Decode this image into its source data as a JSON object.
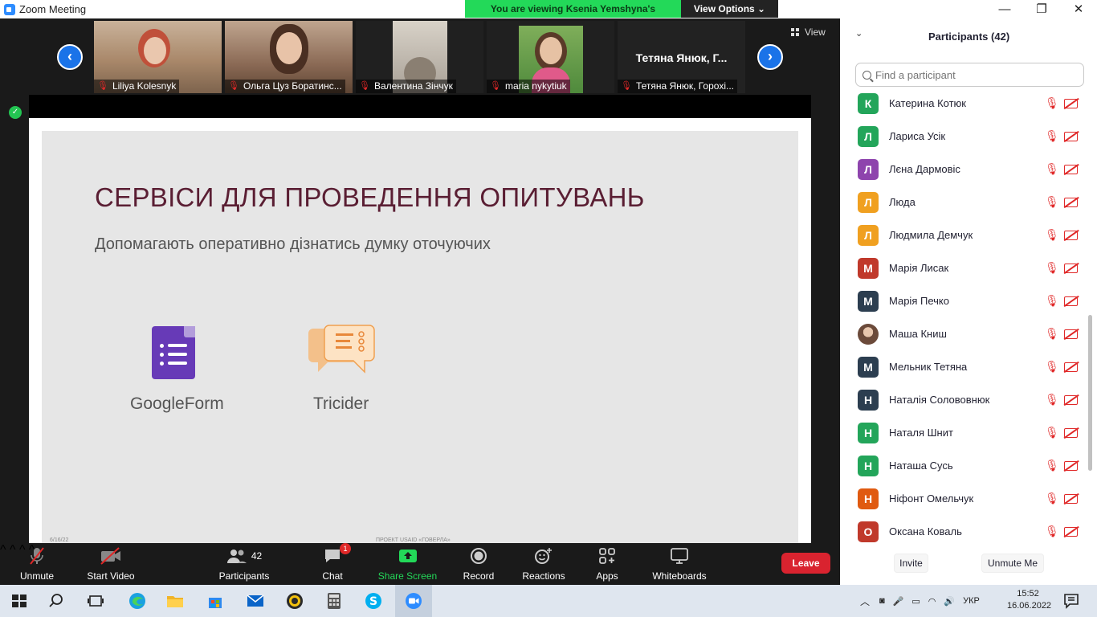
{
  "window": {
    "title": "Zoom Meeting",
    "viewing_banner": "You are viewing Ksenia Yemshyna's screen",
    "view_options": "View Options ⌄"
  },
  "gallery": {
    "view_label": "View",
    "tiles": [
      {
        "name": "Liliya Kolesnyk",
        "photo_color": "#a9886a"
      },
      {
        "name": "Ольга Цуз Боратинс...",
        "photo_color": "#8b6a55"
      },
      {
        "name": "Валентина Зінчук",
        "photo_color": "#c8c2b8"
      },
      {
        "name": "maria nykytiuk",
        "photo_color": "#4f8a3c"
      },
      {
        "name": "Тетяна Янюк, Горохі...",
        "big_name": "Тетяна Янюк, Г..."
      }
    ]
  },
  "slide": {
    "title": "СЕРВІСИ ДЛЯ ПРОВЕДЕННЯ ОПИТУВАНЬ",
    "subtitle": "Допомагають оперативно дізнатись думку оточуючих",
    "item1": "GoogleForm",
    "item2": "Tricider",
    "footer_left": "6/16/22",
    "footer_center": "ПРОЕКТ USAID «ГОВЕРЛА»"
  },
  "toolbar": {
    "unmute": "Unmute",
    "start_video": "Start Video",
    "participants": "Participants",
    "participants_count": "42",
    "chat": "Chat",
    "chat_badge": "1",
    "share_screen": "Share Screen",
    "record": "Record",
    "reactions": "Reactions",
    "apps": "Apps",
    "whiteboards": "Whiteboards",
    "leave": "Leave"
  },
  "participants_panel": {
    "title": "Participants (42)",
    "search_placeholder": "Find a participant",
    "invite": "Invite",
    "unmute_me": "Unmute Me",
    "rows": [
      {
        "initial": "К",
        "name": "Катерина Котюк",
        "color": "#23a55a"
      },
      {
        "initial": "Л",
        "name": "Лариса Усік",
        "color": "#23a55a"
      },
      {
        "initial": "Л",
        "name": "Лєна Дармовіс",
        "color": "#8e44ad"
      },
      {
        "initial": "Л",
        "name": "Люда",
        "color": "#f0a020"
      },
      {
        "initial": "Л",
        "name": "Людмила Демчук",
        "color": "#f0a020"
      },
      {
        "initial": "М",
        "name": "Марія Лисак",
        "color": "#c0392b"
      },
      {
        "initial": "М",
        "name": "Марія Печко",
        "color": "#2c3e50"
      },
      {
        "initial": "",
        "name": "Маша Книш",
        "color": "#c9a88a"
      },
      {
        "initial": "М",
        "name": "Мельник Тетяна",
        "color": "#2c3e50"
      },
      {
        "initial": "Н",
        "name": "Наталія Солововнюк",
        "color": "#2c3e50"
      },
      {
        "initial": "Н",
        "name": "Наталя Шнит",
        "color": "#23a55a"
      },
      {
        "initial": "Н",
        "name": "Наташа Сусь",
        "color": "#23a55a"
      },
      {
        "initial": "Н",
        "name": "Ніфонт Омельчук",
        "color": "#e05a10"
      },
      {
        "initial": "О",
        "name": "Оксана Коваль",
        "color": "#c0392b"
      }
    ]
  },
  "taskbar": {
    "lang": "УКР",
    "time": "15:52",
    "date": "16.06.2022"
  }
}
